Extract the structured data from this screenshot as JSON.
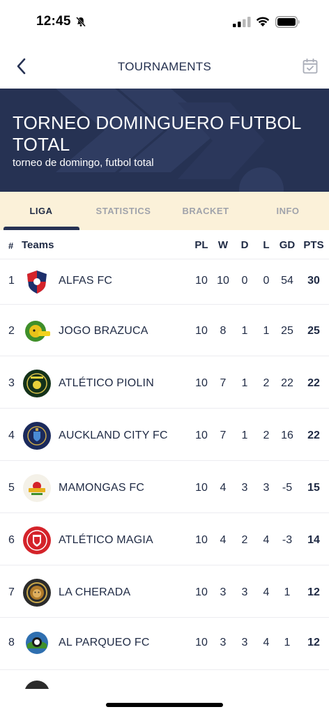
{
  "status_bar": {
    "time": "12:45"
  },
  "nav": {
    "title": "TOURNAMENTS",
    "back_icon": "chevron-left-icon",
    "calendar_icon": "calendar-check-icon"
  },
  "banner": {
    "title": "TORNEO DOMINGUERO FUTBOL TOTAL",
    "subtitle": "torneo de domingo, futbol total",
    "background_color": "#263253"
  },
  "tabs": [
    {
      "label": "LIGA",
      "active": true
    },
    {
      "label": "STATISTICS",
      "active": false
    },
    {
      "label": "BRACKET",
      "active": false
    },
    {
      "label": "INFO",
      "active": false
    }
  ],
  "table": {
    "headers": {
      "num": "#",
      "teams": "Teams",
      "pl": "PL",
      "w": "W",
      "d": "D",
      "l": "L",
      "gd": "GD",
      "pts": "PTS"
    },
    "rows": [
      {
        "pos": "1",
        "team": "ALFAS FC",
        "pl": "10",
        "w": "10",
        "d": "0",
        "l": "0",
        "gd": "54",
        "pts": "30",
        "logo_color": "#1d2f6b"
      },
      {
        "pos": "2",
        "team": "JOGO BRAZUCA",
        "pl": "10",
        "w": "8",
        "d": "1",
        "l": "1",
        "gd": "25",
        "pts": "25",
        "logo_color": "#3f8f2a"
      },
      {
        "pos": "3",
        "team": "ATLÉTICO PIOLIN",
        "pl": "10",
        "w": "7",
        "d": "1",
        "l": "2",
        "gd": "22",
        "pts": "22",
        "logo_color": "#14321a"
      },
      {
        "pos": "4",
        "team": "AUCKLAND CITY FC",
        "pl": "10",
        "w": "7",
        "d": "1",
        "l": "2",
        "gd": "16",
        "pts": "22",
        "logo_color": "#1b2a5c"
      },
      {
        "pos": "5",
        "team": "MAMONGAS FC",
        "pl": "10",
        "w": "4",
        "d": "3",
        "l": "3",
        "gd": "-5",
        "pts": "15",
        "logo_color": "#e9e4d6"
      },
      {
        "pos": "6",
        "team": "ATLÉTICO MAGIA",
        "pl": "10",
        "w": "4",
        "d": "2",
        "l": "4",
        "gd": "-3",
        "pts": "14",
        "logo_color": "#d4232a"
      },
      {
        "pos": "7",
        "team": "LA CHERADA",
        "pl": "10",
        "w": "3",
        "d": "3",
        "l": "4",
        "gd": "1",
        "pts": "12",
        "logo_color": "#2b2b2b"
      },
      {
        "pos": "8",
        "team": "AL PARQUEO FC",
        "pl": "10",
        "w": "3",
        "d": "3",
        "l": "4",
        "gd": "1",
        "pts": "12",
        "logo_color": "#2f6fb0"
      }
    ]
  }
}
